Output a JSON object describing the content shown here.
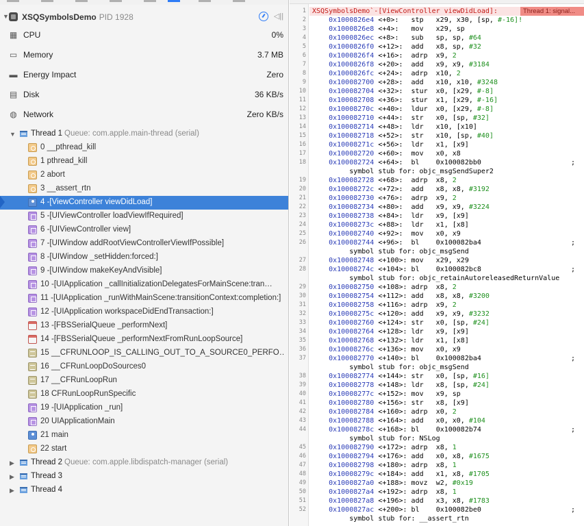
{
  "process": {
    "name": "XSQSymbolsDemo",
    "pid": "PID 1928"
  },
  "gauges": [
    {
      "label": "CPU",
      "value": "0%",
      "icon": "cpu-icon"
    },
    {
      "label": "Memory",
      "value": "3.7 MB",
      "icon": "memory-icon"
    },
    {
      "label": "Energy Impact",
      "value": "Zero",
      "icon": "energy-icon"
    },
    {
      "label": "Disk",
      "value": "36 KB/s",
      "icon": "disk-icon"
    },
    {
      "label": "Network",
      "value": "Zero KB/s",
      "icon": "network-icon"
    }
  ],
  "threads": [
    {
      "name": "Thread 1",
      "queue": "Queue: com.apple.main-thread (serial)"
    },
    {
      "name": "Thread 2",
      "queue": "Queue: com.apple.libdispatch-manager (serial)"
    },
    {
      "name": "Thread 3",
      "queue": ""
    },
    {
      "name": "Thread 4",
      "queue": ""
    }
  ],
  "frames": [
    {
      "label": "0 __pthread_kill",
      "kind": "sys"
    },
    {
      "label": "1 pthread_kill",
      "kind": "sys"
    },
    {
      "label": "2 abort",
      "kind": "sys"
    },
    {
      "label": "3 __assert_rtn",
      "kind": "sys"
    },
    {
      "label": "4 -[ViewController viewDidLoad]",
      "kind": "user"
    },
    {
      "label": "5 -[UIViewController loadViewIfRequired]",
      "kind": "ui"
    },
    {
      "label": "6 -[UIViewController view]",
      "kind": "ui"
    },
    {
      "label": "7 -[UIWindow addRootViewControllerViewIfPossible]",
      "kind": "ui"
    },
    {
      "label": "8 -[UIWindow _setHidden:forced:]",
      "kind": "ui"
    },
    {
      "label": "9 -[UIWindow makeKeyAndVisible]",
      "kind": "ui"
    },
    {
      "label": "10 -[UIApplication _callInitializationDelegatesForMainScene:tran…",
      "kind": "ui"
    },
    {
      "label": "11 -[UIApplication _runWithMainScene:transitionContext:completion:]",
      "kind": "ui"
    },
    {
      "label": "12 -[UIApplication workspaceDidEndTransaction:]",
      "kind": "ui"
    },
    {
      "label": "13 -[FBSSerialQueue _performNext]",
      "kind": "fbs"
    },
    {
      "label": "14 -[FBSSerialQueue _performNextFromRunLoopSource]",
      "kind": "fbs"
    },
    {
      "label": "15 __CFRUNLOOP_IS_CALLING_OUT_TO_A_SOURCE0_PERFO…",
      "kind": "cf"
    },
    {
      "label": "16 __CFRunLoopDoSources0",
      "kind": "cf"
    },
    {
      "label": "17 __CFRunLoopRun",
      "kind": "cf"
    },
    {
      "label": "18 CFRunLoopRunSpecific",
      "kind": "cf"
    },
    {
      "label": "19 -[UIApplication _run]",
      "kind": "ui"
    },
    {
      "label": "20 UIApplicationMain",
      "kind": "ui"
    },
    {
      "label": "21 main",
      "kind": "user"
    },
    {
      "label": "22 start",
      "kind": "sys"
    }
  ],
  "selected_frame_index": 4,
  "disassembly": {
    "header": "XSQSymbolsDemo`-[ViewController viewDidLoad]:",
    "badge": "Thread 1: signal...",
    "lines": [
      {
        "n": "2",
        "addr": "0x1000826e4",
        "off": "<+0>:",
        "op": "stp",
        "args": "x29, x30, [sp, ",
        "lit": "#-16]!"
      },
      {
        "n": "3",
        "addr": "0x1000826e8",
        "off": "<+4>:",
        "op": "mov",
        "args": "x29, sp",
        "lit": ""
      },
      {
        "n": "4",
        "addr": "0x1000826ec",
        "off": "<+8>:",
        "op": "sub",
        "args": "sp, sp, ",
        "lit": "#64"
      },
      {
        "n": "5",
        "addr": "0x1000826f0",
        "off": "<+12>:",
        "op": "add",
        "args": "x8, sp, ",
        "lit": "#32"
      },
      {
        "n": "6",
        "addr": "0x1000826f4",
        "off": "<+16>:",
        "op": "adrp",
        "args": "x9, ",
        "lit": "2"
      },
      {
        "n": "7",
        "addr": "0x1000826f8",
        "off": "<+20>:",
        "op": "add",
        "args": "x9, x9, ",
        "lit": "#3184"
      },
      {
        "n": "8",
        "addr": "0x1000826fc",
        "off": "<+24>:",
        "op": "adrp",
        "args": "x10, ",
        "lit": "2"
      },
      {
        "n": "9",
        "addr": "0x100082700",
        "off": "<+28>:",
        "op": "add",
        "args": "x10, x10, ",
        "lit": "#3248"
      },
      {
        "n": "10",
        "addr": "0x100082704",
        "off": "<+32>:",
        "op": "stur",
        "args": "x0, [x29, ",
        "lit": "#-8]"
      },
      {
        "n": "11",
        "addr": "0x100082708",
        "off": "<+36>:",
        "op": "stur",
        "args": "x1, [x29, ",
        "lit": "#-16]"
      },
      {
        "n": "12",
        "addr": "0x10008270c",
        "off": "<+40>:",
        "op": "ldur",
        "args": "x0, [x29, ",
        "lit": "#-8]"
      },
      {
        "n": "13",
        "addr": "0x100082710",
        "off": "<+44>:",
        "op": "str",
        "args": "x0, [sp, ",
        "lit": "#32]"
      },
      {
        "n": "14",
        "addr": "0x100082714",
        "off": "<+48>:",
        "op": "ldr",
        "args": "x10, [x10]",
        "lit": ""
      },
      {
        "n": "15",
        "addr": "0x100082718",
        "off": "<+52>:",
        "op": "str",
        "args": "x10, [sp, ",
        "lit": "#40]"
      },
      {
        "n": "16",
        "addr": "0x10008271c",
        "off": "<+56>:",
        "op": "ldr",
        "args": "x1, [x9]",
        "lit": ""
      },
      {
        "n": "17",
        "addr": "0x100082720",
        "off": "<+60>:",
        "op": "mov",
        "args": "x0, x8",
        "lit": ""
      },
      {
        "n": "18",
        "addr": "0x100082724",
        "off": "<+64>:",
        "op": "bl",
        "args": "0x100082bb0",
        "lit": "",
        "semi": ";"
      },
      {
        "n": "",
        "stub": "symbol stub for: objc_msgSendSuper2"
      },
      {
        "n": "19",
        "addr": "0x100082728",
        "off": "<+68>:",
        "op": "adrp",
        "args": "x8, ",
        "lit": "2"
      },
      {
        "n": "20",
        "addr": "0x10008272c",
        "off": "<+72>:",
        "op": "add",
        "args": "x8, x8, ",
        "lit": "#3192"
      },
      {
        "n": "21",
        "addr": "0x100082730",
        "off": "<+76>:",
        "op": "adrp",
        "args": "x9, ",
        "lit": "2"
      },
      {
        "n": "22",
        "addr": "0x100082734",
        "off": "<+80>:",
        "op": "add",
        "args": "x9, x9, ",
        "lit": "#3224"
      },
      {
        "n": "23",
        "addr": "0x100082738",
        "off": "<+84>:",
        "op": "ldr",
        "args": "x9, [x9]",
        "lit": ""
      },
      {
        "n": "24",
        "addr": "0x10008273c",
        "off": "<+88>:",
        "op": "ldr",
        "args": "x1, [x8]",
        "lit": ""
      },
      {
        "n": "25",
        "addr": "0x100082740",
        "off": "<+92>:",
        "op": "mov",
        "args": "x0, x9",
        "lit": ""
      },
      {
        "n": "26",
        "addr": "0x100082744",
        "off": "<+96>:",
        "op": "bl",
        "args": "0x100082ba4",
        "lit": "",
        "semi": ";"
      },
      {
        "n": "",
        "stub": "symbol stub for: objc_msgSend"
      },
      {
        "n": "27",
        "addr": "0x100082748",
        "off": "<+100>:",
        "op": "mov",
        "args": "x29, x29",
        "lit": ""
      },
      {
        "n": "28",
        "addr": "0x10008274c",
        "off": "<+104>:",
        "op": "bl",
        "args": "0x100082bc8",
        "lit": "",
        "semi": ";"
      },
      {
        "n": "",
        "stub": "symbol stub for: objc_retainAutoreleasedReturnValue"
      },
      {
        "n": "29",
        "addr": "0x100082750",
        "off": "<+108>:",
        "op": "adrp",
        "args": "x8, ",
        "lit": "2"
      },
      {
        "n": "30",
        "addr": "0x100082754",
        "off": "<+112>:",
        "op": "add",
        "args": "x8, x8, ",
        "lit": "#3200"
      },
      {
        "n": "31",
        "addr": "0x100082758",
        "off": "<+116>:",
        "op": "adrp",
        "args": "x9, ",
        "lit": "2"
      },
      {
        "n": "32",
        "addr": "0x10008275c",
        "off": "<+120>:",
        "op": "add",
        "args": "x9, x9, ",
        "lit": "#3232"
      },
      {
        "n": "33",
        "addr": "0x100082760",
        "off": "<+124>:",
        "op": "str",
        "args": "x0, [sp, ",
        "lit": "#24]"
      },
      {
        "n": "34",
        "addr": "0x100082764",
        "off": "<+128>:",
        "op": "ldr",
        "args": "x9, [x9]",
        "lit": ""
      },
      {
        "n": "35",
        "addr": "0x100082768",
        "off": "<+132>:",
        "op": "ldr",
        "args": "x1, [x8]",
        "lit": ""
      },
      {
        "n": "36",
        "addr": "0x10008276c",
        "off": "<+136>:",
        "op": "mov",
        "args": "x0, x9",
        "lit": ""
      },
      {
        "n": "37",
        "addr": "0x100082770",
        "off": "<+140>:",
        "op": "bl",
        "args": "0x100082ba4",
        "lit": "",
        "semi": ";"
      },
      {
        "n": "",
        "stub": "symbol stub for: objc_msgSend"
      },
      {
        "n": "38",
        "addr": "0x100082774",
        "off": "<+144>:",
        "op": "str",
        "args": "x0, [sp, ",
        "lit": "#16]"
      },
      {
        "n": "39",
        "addr": "0x100082778",
        "off": "<+148>:",
        "op": "ldr",
        "args": "x8, [sp, ",
        "lit": "#24]"
      },
      {
        "n": "40",
        "addr": "0x10008277c",
        "off": "<+152>:",
        "op": "mov",
        "args": "x9, sp",
        "lit": ""
      },
      {
        "n": "41",
        "addr": "0x100082780",
        "off": "<+156>:",
        "op": "str",
        "args": "x8, [x9]",
        "lit": ""
      },
      {
        "n": "42",
        "addr": "0x100082784",
        "off": "<+160>:",
        "op": "adrp",
        "args": "x0, ",
        "lit": "2"
      },
      {
        "n": "43",
        "addr": "0x100082788",
        "off": "<+164>:",
        "op": "add",
        "args": "x0, x0, ",
        "lit": "#104"
      },
      {
        "n": "44",
        "addr": "0x10008278c",
        "off": "<+168>:",
        "op": "bl",
        "args": "0x100082b74",
        "lit": "",
        "semi": ";"
      },
      {
        "n": "",
        "stub": "symbol stub for: NSLog"
      },
      {
        "n": "45",
        "addr": "0x100082790",
        "off": "<+172>:",
        "op": "adrp",
        "args": "x8, ",
        "lit": "1"
      },
      {
        "n": "46",
        "addr": "0x100082794",
        "off": "<+176>:",
        "op": "add",
        "args": "x0, x8, ",
        "lit": "#1675"
      },
      {
        "n": "47",
        "addr": "0x100082798",
        "off": "<+180>:",
        "op": "adrp",
        "args": "x8, ",
        "lit": "1"
      },
      {
        "n": "48",
        "addr": "0x10008279c",
        "off": "<+184>:",
        "op": "add",
        "args": "x1, x8, ",
        "lit": "#1705"
      },
      {
        "n": "49",
        "addr": "0x1000827a0",
        "off": "<+188>:",
        "op": "movz",
        "args": "w2, ",
        "lit": "#0x19"
      },
      {
        "n": "50",
        "addr": "0x1000827a4",
        "off": "<+192>:",
        "op": "adrp",
        "args": "x8, ",
        "lit": "1"
      },
      {
        "n": "51",
        "addr": "0x1000827a8",
        "off": "<+196>:",
        "op": "add",
        "args": "x3, x8, ",
        "lit": "#1783"
      },
      {
        "n": "52",
        "addr": "0x1000827ac",
        "off": "<+200>:",
        "op": "bl",
        "args": "0x100082be0",
        "lit": "",
        "semi": ";"
      },
      {
        "n": "",
        "stub": "symbol stub for: __assert_rtn"
      }
    ]
  }
}
